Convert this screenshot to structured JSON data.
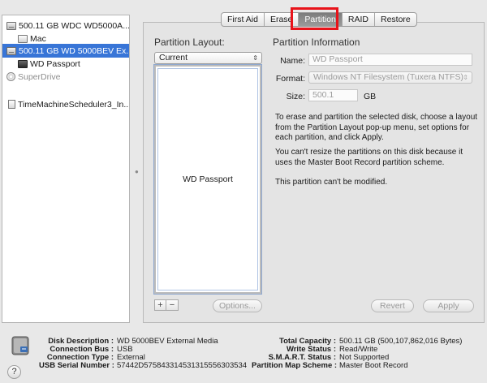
{
  "sidebar": {
    "items": [
      {
        "label": "500.11 GB WDC WD5000A...",
        "icon": "hard-drive-icon",
        "level": 0,
        "selected": false
      },
      {
        "label": "Mac",
        "icon": "volume-icon",
        "level": 1,
        "selected": false
      },
      {
        "label": "500.11 GB WD 5000BEV Ex...",
        "icon": "hard-drive-icon",
        "level": 0,
        "selected": true
      },
      {
        "label": "WD Passport",
        "icon": "volume-icon",
        "level": 1,
        "selected": false
      },
      {
        "label": "SuperDrive",
        "icon": "optical-drive-icon",
        "level": 0,
        "selected": false
      },
      {
        "label": "TimeMachineScheduler3_In...",
        "icon": "disk-image-icon",
        "level": 0,
        "selected": false
      }
    ]
  },
  "tabs": [
    {
      "label": "First Aid",
      "active": false
    },
    {
      "label": "Erase",
      "active": false
    },
    {
      "label": "Partition",
      "active": true
    },
    {
      "label": "RAID",
      "active": false
    },
    {
      "label": "Restore",
      "active": false
    }
  ],
  "partition_layout": {
    "title": "Partition Layout:",
    "selected": "Current",
    "partition_name": "WD Passport",
    "plus": "+",
    "minus": "−",
    "options_button": "Options..."
  },
  "partition_info": {
    "title": "Partition Information",
    "name_label": "Name:",
    "name_value": "WD Passport",
    "format_label": "Format:",
    "format_value": "Windows NT Filesystem (Tuxera NTFS)",
    "size_label": "Size:",
    "size_value": "500.1",
    "size_unit": "GB",
    "paragraph1": "To erase and partition the selected disk, choose a layout from the Partition Layout pop-up menu, set options for each partition, and click Apply.",
    "paragraph2": "You can't resize the partitions on this disk because it uses the Master Boot Record partition scheme.",
    "paragraph3": "This partition can't be modified.",
    "revert_button": "Revert",
    "apply_button": "Apply"
  },
  "disk_info_left": [
    {
      "key": "Disk Description :",
      "value": "WD 5000BEV External Media"
    },
    {
      "key": "Connection Bus :",
      "value": "USB"
    },
    {
      "key": "Connection Type :",
      "value": "External"
    },
    {
      "key": "USB Serial Number :",
      "value": "57442D575843314531315556303534"
    }
  ],
  "disk_info_right": [
    {
      "key": "Total Capacity :",
      "value": "500.11 GB (500,107,862,016 Bytes)"
    },
    {
      "key": "Write Status :",
      "value": "Read/Write"
    },
    {
      "key": "S.M.A.R.T. Status :",
      "value": "Not Supported"
    },
    {
      "key": "Partition Map Scheme :",
      "value": "Master Boot Record"
    }
  ],
  "help": "?",
  "colors": {
    "selection": "#3875d7",
    "highlight": "#e8131a"
  }
}
